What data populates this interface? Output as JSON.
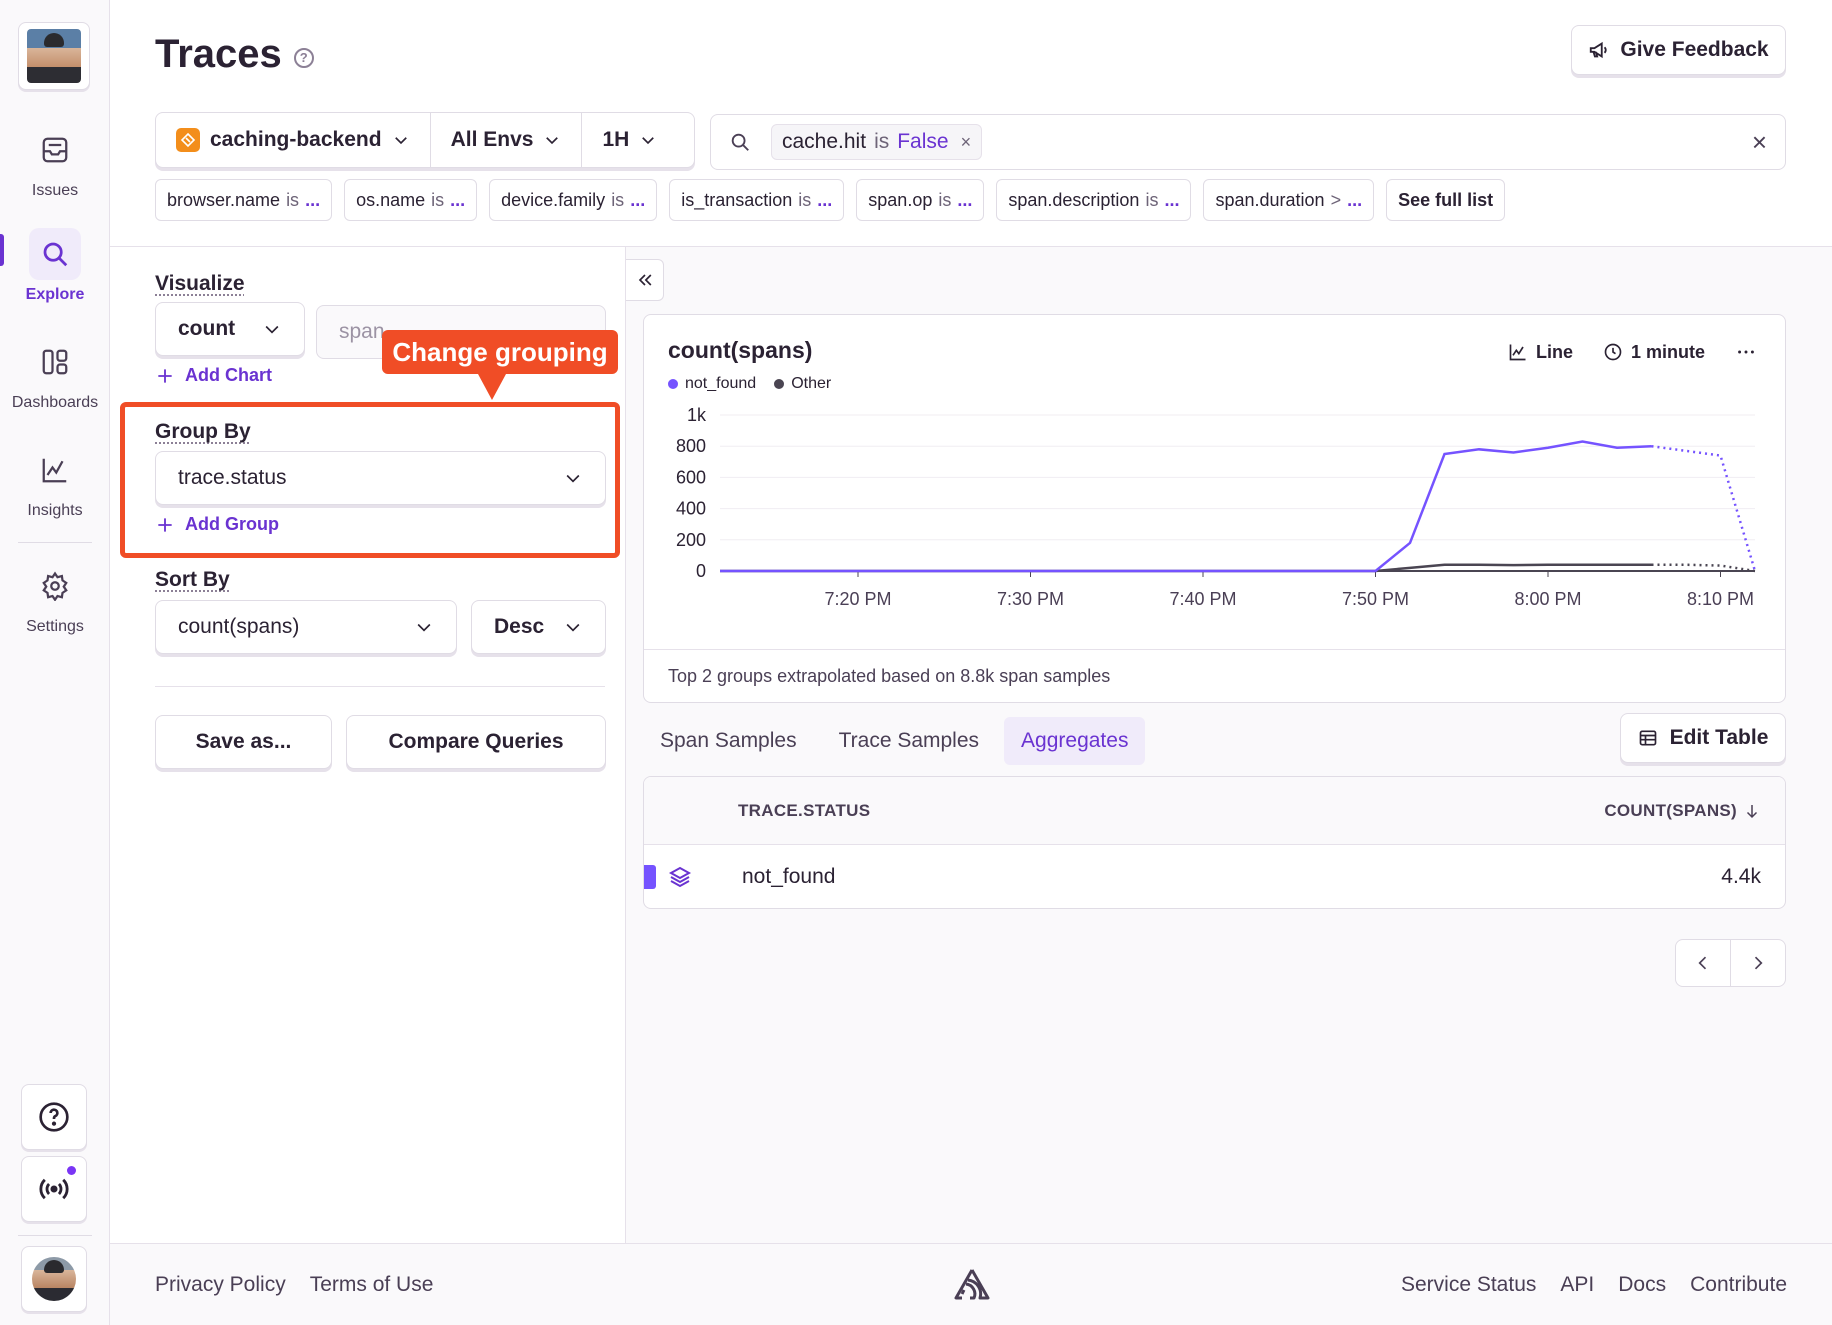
{
  "sidebar": {
    "items": [
      {
        "label": "Issues",
        "icon": "inbox-icon"
      },
      {
        "label": "Explore",
        "icon": "search-icon"
      },
      {
        "label": "Dashboards",
        "icon": "dashboard-icon"
      },
      {
        "label": "Insights",
        "icon": "chart-icon"
      },
      {
        "label": "Settings",
        "icon": "gear-icon"
      }
    ],
    "accent": "#6a33d1"
  },
  "header": {
    "title": "Traces",
    "feedback_label": "Give Feedback"
  },
  "filters": {
    "project": "caching-backend",
    "env": "All Envs",
    "period": "1H"
  },
  "search": {
    "token_key": "cache.hit",
    "token_op": "is",
    "token_value": "False"
  },
  "suggestions": [
    {
      "key": "browser.name",
      "op": "is",
      "val": "..."
    },
    {
      "key": "os.name",
      "op": "is",
      "val": "..."
    },
    {
      "key": "device.family",
      "op": "is",
      "val": "..."
    },
    {
      "key": "is_transaction",
      "op": "is",
      "val": "..."
    },
    {
      "key": "span.op",
      "op": "is",
      "val": "..."
    },
    {
      "key": "span.description",
      "op": "is",
      "val": "..."
    },
    {
      "key": "span.duration",
      "op": ">",
      "val": "..."
    }
  ],
  "see_full_list": "See full list",
  "controls": {
    "visualize_label": "Visualize",
    "visualize_fn": "count",
    "visualize_field": "span",
    "add_chart": "Add Chart",
    "group_by_label": "Group By",
    "group_by_value": "trace.status",
    "add_group": "Add Group",
    "sort_by_label": "Sort By",
    "sort_by_value": "count(spans)",
    "sort_dir": "Desc",
    "save_as": "Save as...",
    "compare": "Compare Queries"
  },
  "callout": {
    "text": "Change grouping",
    "color": "#f04d26"
  },
  "chart": {
    "line_label": "Line",
    "interval_label": "1 minute",
    "footer": "Top 2 groups extrapolated based on 8.8k span samples"
  },
  "chart_data": {
    "type": "line",
    "title": "count(spans)",
    "legend_position": "top-left",
    "xlabel": "",
    "ylabel": "",
    "x_ticks": [
      "7:20 PM",
      "7:30 PM",
      "7:40 PM",
      "7:50 PM",
      "8:00 PM",
      "8:10 PM"
    ],
    "y_ticks": [
      "0",
      "200",
      "400",
      "600",
      "800",
      "1k"
    ],
    "ylim": [
      0,
      1000
    ],
    "x": [
      0,
      38,
      40,
      42,
      44,
      46,
      48,
      50,
      52,
      54,
      56,
      58,
      60
    ],
    "x_note_minutes_from": "7:12 PM",
    "series": [
      {
        "name": "not_found",
        "color": "#7553ff",
        "values": [
          0,
          0,
          180,
          750,
          780,
          760,
          790,
          830,
          790,
          800,
          770,
          740,
          0
        ],
        "dotted_from_index": 9
      },
      {
        "name": "Other",
        "color": "#4a4552",
        "values": [
          0,
          0,
          20,
          40,
          40,
          38,
          40,
          40,
          40,
          40,
          40,
          35,
          0
        ],
        "dotted_from_index": 9
      }
    ],
    "grid": true
  },
  "tabs": [
    {
      "label": "Span Samples"
    },
    {
      "label": "Trace Samples"
    },
    {
      "label": "Aggregates"
    }
  ],
  "edit_table": "Edit Table",
  "table": {
    "columns": [
      "TRACE.STATUS",
      "COUNT(SPANS)"
    ],
    "rows": [
      {
        "status": "not_found",
        "count": "4.4k"
      }
    ]
  },
  "footer": {
    "left": [
      "Privacy Policy",
      "Terms of Use"
    ],
    "right": [
      "Service Status",
      "API",
      "Docs",
      "Contribute"
    ]
  }
}
